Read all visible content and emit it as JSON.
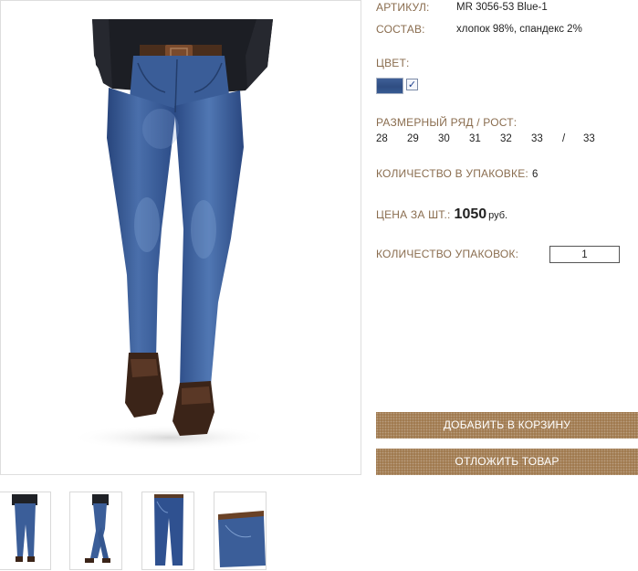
{
  "product": {
    "sku_label": "АРТИКУЛ:",
    "sku_value": "MR 3056-53 Blue-1",
    "composition_label": "СОСТАВ:",
    "composition_value": "хлопок 98%, спандекс 2%",
    "color_label": "ЦВЕТ:",
    "colors": [
      {
        "name": "blue-denim",
        "hex": "#34538a",
        "selected": true
      }
    ],
    "size_label": "РАЗМЕРНЫЙ РЯД / РОСТ:",
    "sizes": [
      "28",
      "29",
      "30",
      "31",
      "32",
      "33",
      "/",
      "33"
    ],
    "pack_qty_label": "КОЛИЧЕСТВО В УПАКОВКЕ:",
    "pack_qty_value": "6",
    "price_label": "ЦЕНА ЗА ШТ.:",
    "price_value": "1050",
    "price_currency": "руб.",
    "packs_label": "КОЛИЧЕСТВО УПАКОВОК:",
    "packs_value": "1"
  },
  "buttons": {
    "add_to_cart": "ДОБАВИТЬ В КОРЗИНУ",
    "save_for_later": "ОТЛОЖИТЬ ТОВАР"
  },
  "gallery": {
    "thumbnails": [
      "front-view",
      "side-view",
      "flat-front",
      "waistband-detail"
    ],
    "selected": 0
  },
  "colors": {
    "label": "#8a6d4f",
    "button": "#a07a4f",
    "denim": "#34538a"
  }
}
